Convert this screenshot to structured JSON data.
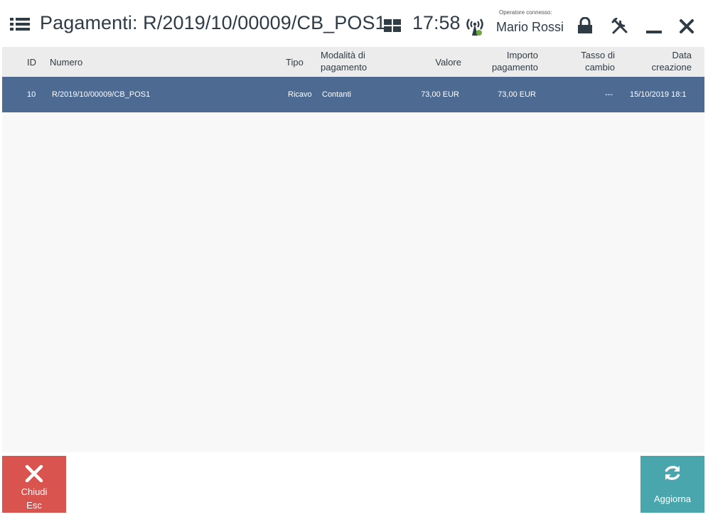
{
  "header": {
    "title": "Pagamenti: R/2019/10/00009/CB_POS1",
    "clock": "17:58",
    "operator_caption": "Operatore connesso:",
    "operator_name": "Mario Rossi"
  },
  "table": {
    "columns": {
      "id": "ID",
      "numero": "Numero",
      "tipo": "Tipo",
      "modalita_1": "Modalità di",
      "modalita_2": "pagamento",
      "valore": "Valore",
      "importo_1": "Importo",
      "importo_2": "pagamento",
      "tasso_1": "Tasso di",
      "tasso_2": "cambio",
      "data_1": "Data",
      "data_2": "creazione"
    },
    "rows": [
      {
        "id": "10",
        "numero": "R/2019/10/00009/CB_POS1",
        "tipo": "Ricavo",
        "modalita": "Contanti",
        "valore": "73,00 EUR",
        "importo": "73,00 EUR",
        "tasso": "---",
        "data": "15/10/2019 18:1"
      }
    ]
  },
  "buttons": {
    "close_label": "Chiudi",
    "close_shortcut": "Esc",
    "refresh_label": "Aggiorna"
  },
  "colors": {
    "selected_row": "#4d6a93",
    "close_button": "#d9534f",
    "refresh_button": "#4aa6ad"
  }
}
